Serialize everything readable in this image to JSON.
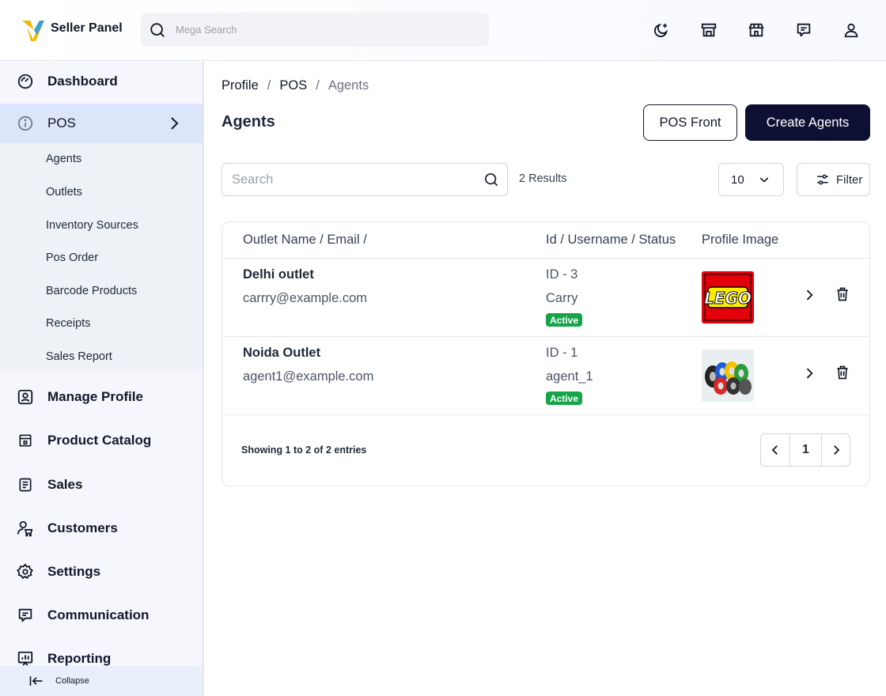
{
  "header": {
    "brand": "Seller Panel",
    "search_placeholder": "Mega Search",
    "icons": [
      "moon-star-icon",
      "store-icon",
      "shop-icon",
      "message-icon",
      "user-icon"
    ]
  },
  "sidebar": {
    "items": [
      {
        "label": "Dashboard",
        "icon": "gauge-icon"
      },
      {
        "label": "POS",
        "icon": "info-icon"
      },
      {
        "label": "Manage Profile",
        "icon": "profile-icon"
      },
      {
        "label": "Product Catalog",
        "icon": "catalog-icon"
      },
      {
        "label": "Sales",
        "icon": "document-icon"
      },
      {
        "label": "Customers",
        "icon": "customers-icon"
      },
      {
        "label": "Settings",
        "icon": "gear-icon"
      },
      {
        "label": "Communication",
        "icon": "chat-icon"
      },
      {
        "label": "Reporting",
        "icon": "chart-icon"
      }
    ],
    "pos_sub": [
      "Agents",
      "Outlets",
      "Inventory Sources",
      "Pos Order",
      "Barcode Products",
      "Receipts",
      "Sales Report"
    ],
    "collapse_label": "Collapse"
  },
  "breadcrumb": [
    "Profile",
    "POS",
    "Agents"
  ],
  "page": {
    "title": "Agents",
    "pos_front_label": "POS Front",
    "create_label": "Create Agents"
  },
  "toolbar": {
    "search_placeholder": "Search",
    "results": "2 Results",
    "per_page": "10",
    "filter_label": "Filter"
  },
  "table": {
    "headers": [
      "Outlet Name / Email /",
      "Id / Username / Status",
      "Profile Image"
    ],
    "rows": [
      {
        "name": "Delhi outlet",
        "email": "carrry@example.com",
        "id": "ID - 3",
        "username": "Carry",
        "status": "Active",
        "image": "lego-logo"
      },
      {
        "name": "Noida Outlet",
        "email": "agent1@example.com",
        "id": "ID - 1",
        "username": "agent_1",
        "status": "Active",
        "image": "tyres-photo"
      }
    ]
  },
  "footer": {
    "showing": "Showing 1 to 2 of 2 entries",
    "page": "1"
  },
  "colors": {
    "primary_button": "#0d1033",
    "active_badge": "#16a34a",
    "active_nav": "#dde5fa",
    "sidebar_bg": "#f5f7fd"
  }
}
